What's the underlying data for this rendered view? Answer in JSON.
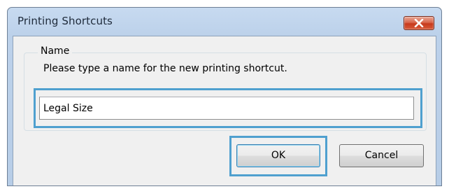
{
  "window": {
    "title": "Printing Shortcuts"
  },
  "name_group": {
    "label": "Name",
    "prompt": "Please type a name for the new printing shortcut.",
    "input_value": "Legal Size"
  },
  "buttons": {
    "ok_label": "OK",
    "cancel_label": "Cancel"
  },
  "icons": {
    "close": "close-icon"
  },
  "colors": {
    "highlight": "#4fa0cf",
    "close_button": "#c7391c",
    "titlebar": "#c7daf0"
  }
}
